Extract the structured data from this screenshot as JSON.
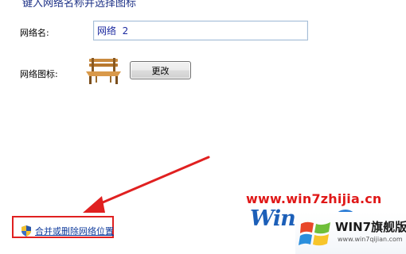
{
  "heading": "键入网络名称并选择图标",
  "form": {
    "name_label": "网络名:",
    "name_value": "网络  2",
    "icon_label": "网络图标:",
    "change_button": "更改"
  },
  "link": {
    "label": "合并或删除网络位置"
  },
  "watermark": {
    "url": "www.win7zhijia.cn",
    "logo_text": "Win"
  },
  "brand": {
    "title": "WIN7旗舰版",
    "url": "www.win7qijian.com"
  },
  "colors": {
    "accent_red": "#e02020",
    "link_blue": "#0f3b9c",
    "heading_blue": "#1e3287"
  },
  "icons": [
    "bench-icon",
    "uac-shield-icon",
    "windows-flag-icon"
  ]
}
